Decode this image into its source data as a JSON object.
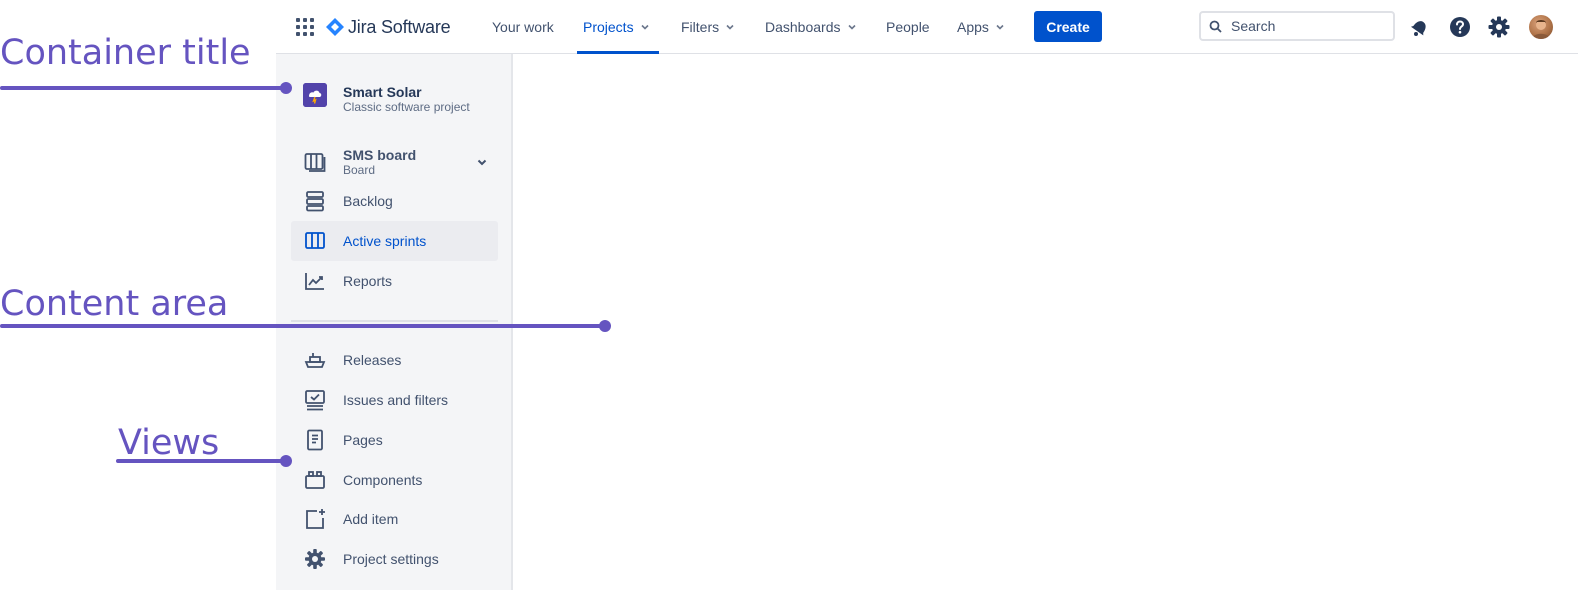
{
  "topnav": {
    "logo_text": "Jira Software",
    "items": [
      {
        "label": "Your work",
        "dropdown": false
      },
      {
        "label": "Projects",
        "dropdown": true,
        "active": true
      },
      {
        "label": "Filters",
        "dropdown": true
      },
      {
        "label": "Dashboards",
        "dropdown": true
      },
      {
        "label": "People",
        "dropdown": false
      },
      {
        "label": "Apps",
        "dropdown": true
      }
    ],
    "create_label": "Create",
    "search_placeholder": "Search",
    "icons": [
      "notifications-icon",
      "help-icon",
      "settings-icon",
      "avatar"
    ]
  },
  "sidebar": {
    "project": {
      "name": "Smart Solar",
      "type": "Classic software project"
    },
    "board": {
      "label": "SMS board",
      "sub": "Board"
    },
    "items": [
      {
        "label": "Backlog",
        "icon": "backlog-icon"
      },
      {
        "label": "Active sprints",
        "icon": "active-sprints-icon",
        "selected": true
      },
      {
        "label": "Reports",
        "icon": "reports-icon"
      }
    ],
    "items2": [
      {
        "label": "Releases",
        "icon": "releases-icon"
      },
      {
        "label": "Issues and filters",
        "icon": "issues-filters-icon"
      },
      {
        "label": "Pages",
        "icon": "pages-icon"
      },
      {
        "label": "Components",
        "icon": "components-icon"
      },
      {
        "label": "Add item",
        "icon": "add-item-icon"
      },
      {
        "label": "Project settings",
        "icon": "project-settings-icon"
      }
    ]
  },
  "annotations": {
    "container_title": "Container title",
    "content_area": "Content area",
    "views": "Views"
  },
  "colors": {
    "primary": "#0052cc",
    "annotation": "#6554c0",
    "sidebar_bg": "#f4f5f7",
    "selected_bg": "#ebecf0",
    "text": "#42526e"
  }
}
